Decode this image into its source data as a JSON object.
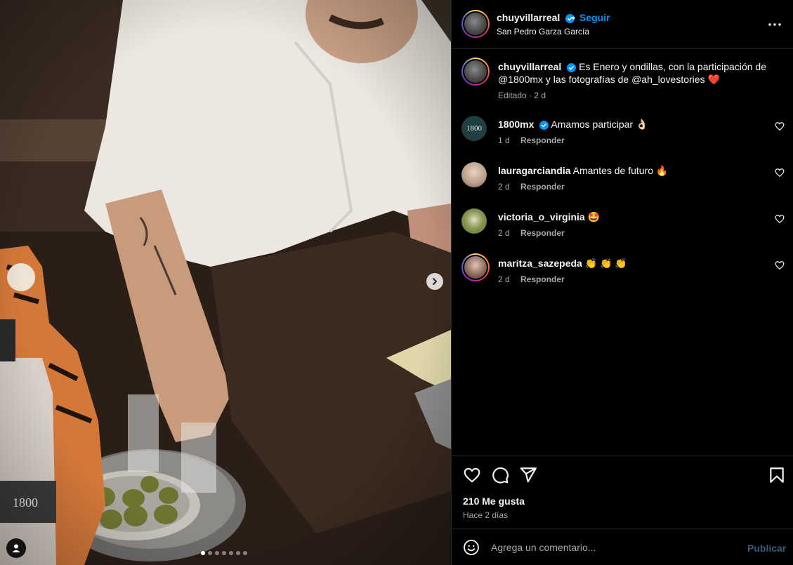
{
  "post": {
    "username": "chuyvillarreal",
    "follow_label": "Seguir",
    "separator": "•",
    "location": "San Pedro Garza García",
    "caption_text_1": "Es Enero y ondillas, con la participación de",
    "caption_text_2": "@1800mx y las fotografías de @ah_lovestories",
    "caption_heart": "❤️",
    "caption_meta": "Editado · 2 d",
    "product_label": "1800",
    "carousel_total": 7,
    "carousel_index": 1
  },
  "comments": [
    {
      "user": "1800mx",
      "verified": true,
      "text": "Amamos participar 👌🏻",
      "time": "1 d",
      "reply": "Responder",
      "avatar_label": "1800"
    },
    {
      "user": "lauragarciandia",
      "verified": false,
      "text": "Amantes de futuro 🔥",
      "time": "2 d",
      "reply": "Responder"
    },
    {
      "user": "victoria_o_virginia",
      "verified": false,
      "text": "🤩",
      "time": "2 d",
      "reply": "Responder"
    },
    {
      "user": "maritza_sazepeda",
      "verified": false,
      "text": "👏 👏 👏",
      "time": "2 d",
      "reply": "Responder"
    }
  ],
  "footer": {
    "likes": "210 Me gusta",
    "time_ago": "Hace 2 días",
    "comment_placeholder": "Agrega un comentario...",
    "publish_label": "Publicar"
  },
  "icons": [
    "heart-icon",
    "comment-icon",
    "share-icon",
    "bookmark-icon",
    "emoji-icon",
    "more-icon",
    "verified-icon",
    "chevron-right-icon",
    "user-tag-icon"
  ],
  "colors": {
    "accent": "#0095f6",
    "verified": "#0095f6",
    "muted": "#a8a8a8",
    "panel_bg": "#000000",
    "border": "#262626"
  }
}
